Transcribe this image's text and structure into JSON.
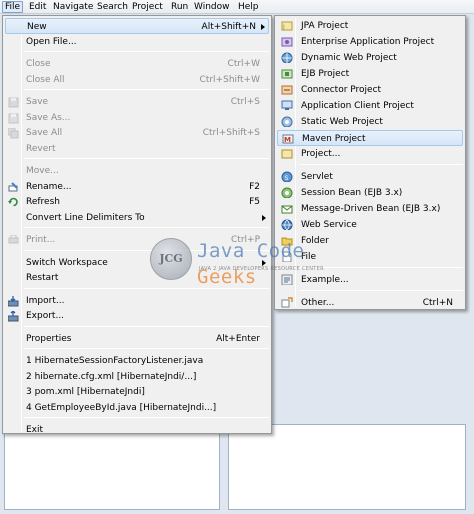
{
  "menubar": [
    {
      "label": "File",
      "active": true
    },
    {
      "label": "Edit"
    },
    {
      "label": "Navigate"
    },
    {
      "label": "Search"
    },
    {
      "label": "Project"
    },
    {
      "label": "Run"
    },
    {
      "label": "Window"
    },
    {
      "label": "Help"
    }
  ],
  "file_menu": [
    {
      "label": "New",
      "shortcut": "Alt+Shift+N",
      "submenu": true,
      "highlight": true
    },
    {
      "label": "Open File..."
    },
    {
      "sep": true
    },
    {
      "label": "Close",
      "shortcut": "Ctrl+W",
      "disabled": true
    },
    {
      "label": "Close All",
      "shortcut": "Ctrl+Shift+W",
      "disabled": true
    },
    {
      "sep": true
    },
    {
      "label": "Save",
      "shortcut": "Ctrl+S",
      "disabled": true,
      "icon": "save-icon"
    },
    {
      "label": "Save As...",
      "disabled": true,
      "icon": "save-as-icon"
    },
    {
      "label": "Save All",
      "shortcut": "Ctrl+Shift+S",
      "disabled": true,
      "icon": "save-all-icon"
    },
    {
      "label": "Revert",
      "disabled": true
    },
    {
      "sep": true
    },
    {
      "label": "Move...",
      "disabled": true
    },
    {
      "label": "Rename...",
      "shortcut": "F2",
      "icon": "rename-icon"
    },
    {
      "label": "Refresh",
      "shortcut": "F5",
      "icon": "refresh-icon"
    },
    {
      "label": "Convert Line Delimiters To",
      "submenu": true
    },
    {
      "sep": true
    },
    {
      "label": "Print...",
      "shortcut": "Ctrl+P",
      "disabled": true,
      "icon": "print-icon"
    },
    {
      "sep": true
    },
    {
      "label": "Switch Workspace",
      "submenu": true
    },
    {
      "label": "Restart"
    },
    {
      "sep": true
    },
    {
      "label": "Import...",
      "icon": "import-icon"
    },
    {
      "label": "Export...",
      "icon": "export-icon"
    },
    {
      "sep": true
    },
    {
      "label": "Properties",
      "shortcut": "Alt+Enter"
    },
    {
      "sep": true
    },
    {
      "label": "1 HibernateSessionFactoryListener.java"
    },
    {
      "label": "2 hibernate.cfg.xml  [HibernateJndi/...]"
    },
    {
      "label": "3 pom.xml  [HibernateJndi]"
    },
    {
      "label": "4 GetEmployeeById.java  [HibernateJndi...]"
    },
    {
      "sep": true
    },
    {
      "label": "Exit"
    }
  ],
  "new_submenu": [
    {
      "label": "JPA Project",
      "icon": "jpa-project-icon"
    },
    {
      "label": "Enterprise Application Project",
      "icon": "enterprise-app-icon"
    },
    {
      "label": "Dynamic Web Project",
      "icon": "web-project-icon"
    },
    {
      "label": "EJB Project",
      "icon": "ejb-project-icon"
    },
    {
      "label": "Connector Project",
      "icon": "connector-project-icon"
    },
    {
      "label": "Application Client Project",
      "icon": "app-client-icon"
    },
    {
      "label": "Static Web Project",
      "icon": "static-web-icon"
    },
    {
      "label": "Maven Project",
      "icon": "maven-icon",
      "highlight": true
    },
    {
      "label": "Project...",
      "icon": "project-icon"
    },
    {
      "sep": true
    },
    {
      "label": "Servlet",
      "icon": "servlet-icon"
    },
    {
      "label": "Session Bean (EJB 3.x)",
      "icon": "session-bean-icon"
    },
    {
      "label": "Message-Driven Bean (EJB 3.x)",
      "icon": "mdb-icon"
    },
    {
      "label": "Web Service",
      "icon": "web-service-icon"
    },
    {
      "label": "Folder",
      "icon": "folder-icon"
    },
    {
      "label": "File",
      "icon": "file-icon"
    },
    {
      "sep": true
    },
    {
      "label": "Example...",
      "icon": "example-icon"
    },
    {
      "sep": true
    },
    {
      "label": "Other...",
      "shortcut": "Ctrl+N",
      "icon": "other-icon"
    }
  ],
  "watermark": {
    "logo_text": "JCG",
    "title_java": "Java ",
    "title_code": "Code ",
    "title_geeks": "Geeks",
    "tagline": "JAVA 2 JAVA DEVELOPERS RESOURCE CENTER"
  },
  "colors": {
    "menu_bg": "#f0f0f0",
    "highlight_border": "#a8c8ec",
    "java_blue": "#4d7bb3",
    "geeks_orange": "#e9812b"
  }
}
